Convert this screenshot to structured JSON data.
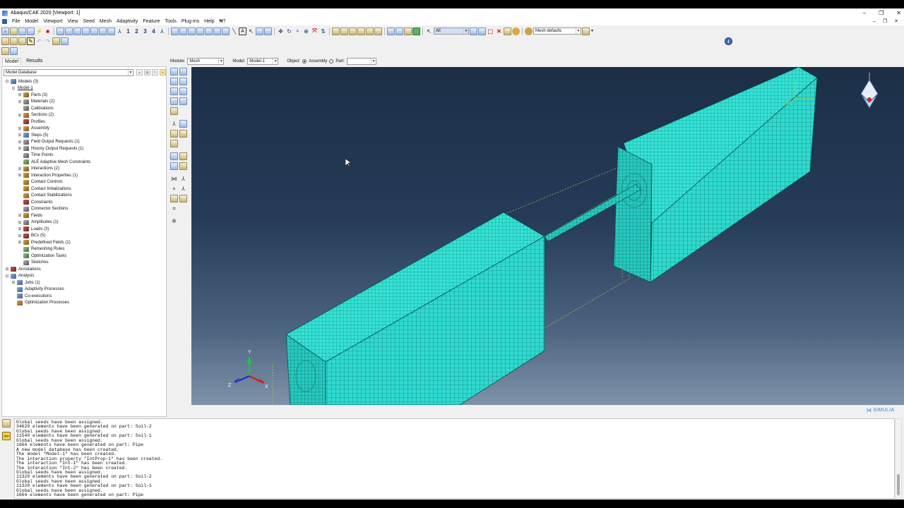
{
  "window": {
    "title": "Abaqus/CAE 2020 [Viewport: 1]",
    "controls": [
      "–",
      "❐",
      "✕"
    ]
  },
  "menu": {
    "items": [
      "File",
      "Model",
      "Viewport",
      "View",
      "Seed",
      "Mesh",
      "Adaptivity",
      "Feature",
      "Tools",
      "Plug-ins",
      "Help",
      "₦?"
    ],
    "right_controls": [
      "–",
      "❐",
      "✕"
    ]
  },
  "toolbar": {
    "numbers": [
      "1",
      "2",
      "3",
      "4"
    ],
    "selection_filter": "All",
    "render_style": "Mesh defaults"
  },
  "left_panel": {
    "tabs": [
      "Model",
      "Results"
    ],
    "tree_combo": "Model Database",
    "tree": [
      {
        "label": "Models (3)",
        "level": 0,
        "expander": "⊟",
        "icon": "c2"
      },
      {
        "label": "Model-1",
        "level": 1,
        "expander": "⊟",
        "icon": "",
        "underline": true
      },
      {
        "label": "Parts (3)",
        "level": 2,
        "expander": "⊞",
        "icon": "c1"
      },
      {
        "label": "Materials (2)",
        "level": 2,
        "expander": "⊞",
        "icon": "c5"
      },
      {
        "label": "Calibrations",
        "level": 2,
        "expander": "",
        "icon": "c5"
      },
      {
        "label": "Sections (2)",
        "level": 2,
        "expander": "⊞",
        "icon": "c1"
      },
      {
        "label": "Profiles",
        "level": 2,
        "expander": "",
        "icon": "c3"
      },
      {
        "label": "Assembly",
        "level": 2,
        "expander": "⊞",
        "icon": "c1"
      },
      {
        "label": "Steps (5)",
        "level": 2,
        "expander": "⊞",
        "icon": "c2"
      },
      {
        "label": "Field Output Requests (1)",
        "level": 2,
        "expander": "⊞",
        "icon": "c5"
      },
      {
        "label": "History Output Requests (1)",
        "level": 2,
        "expander": "⊞",
        "icon": "c5"
      },
      {
        "label": "Time Points",
        "level": 2,
        "expander": "",
        "icon": "c5"
      },
      {
        "label": "ALE Adaptive Mesh Constraints",
        "level": 2,
        "expander": "",
        "icon": "c4"
      },
      {
        "label": "Interactions (2)",
        "level": 2,
        "expander": "⊞",
        "icon": "c1"
      },
      {
        "label": "Interaction Properties (1)",
        "level": 2,
        "expander": "⊞",
        "icon": "c1"
      },
      {
        "label": "Contact Controls",
        "level": 2,
        "expander": "",
        "icon": "c1"
      },
      {
        "label": "Contact Initializations",
        "level": 2,
        "expander": "",
        "icon": "c1"
      },
      {
        "label": "Contact Stabilizations",
        "level": 2,
        "expander": "",
        "icon": "c1"
      },
      {
        "label": "Constraints",
        "level": 2,
        "expander": "",
        "icon": "c3"
      },
      {
        "label": "Connector Sections",
        "level": 2,
        "expander": "",
        "icon": "c5"
      },
      {
        "label": "Fields",
        "level": 2,
        "expander": "⊞",
        "icon": "c1"
      },
      {
        "label": "Amplitudes (1)",
        "level": 2,
        "expander": "⊞",
        "icon": "c5"
      },
      {
        "label": "Loads (3)",
        "level": 2,
        "expander": "⊞",
        "icon": "c3"
      },
      {
        "label": "BCs (5)",
        "level": 2,
        "expander": "⊞",
        "icon": "c3"
      },
      {
        "label": "Predefined Fields (1)",
        "level": 2,
        "expander": "⊞",
        "icon": "c1"
      },
      {
        "label": "Remeshing Rules",
        "level": 2,
        "expander": "",
        "icon": "c4"
      },
      {
        "label": "Optimization Tasks",
        "level": 2,
        "expander": "",
        "icon": "c4"
      },
      {
        "label": "Sketches",
        "level": 2,
        "expander": "",
        "icon": "c5"
      },
      {
        "label": "Annotations",
        "level": 0,
        "expander": "⊞",
        "icon": "c3"
      },
      {
        "label": "Analysis",
        "level": 0,
        "expander": "⊟",
        "icon": "c2"
      },
      {
        "label": "Jobs (1)",
        "level": 1,
        "expander": "⊞",
        "icon": "c2"
      },
      {
        "label": "Adaptivity Processes",
        "level": 1,
        "expander": "",
        "icon": "c2"
      },
      {
        "label": "Co-executions",
        "level": 1,
        "expander": "",
        "icon": "c2"
      },
      {
        "label": "Optimization Processes",
        "level": 1,
        "expander": "",
        "icon": "c1"
      }
    ]
  },
  "context": {
    "module_label": "Module:",
    "module_value": "Mesh",
    "model_label": "Model:",
    "model_value": "Model-1",
    "object_label": "Object:",
    "assembly_label": "Assembly",
    "part_label": "Part:",
    "part_value": ""
  },
  "viewport": {
    "background_top": "#1c2f47",
    "background_bottom": "#7f92aa",
    "mesh_color": "#29d8cc",
    "triad_labels": {
      "x": "X",
      "y": "Y",
      "z": "Z"
    }
  },
  "branding": {
    "text": "SIMULIA"
  },
  "messages": [
    "Global seeds have been assigned.",
    "34620 elements have been generated on part: Soil-2",
    "Global seeds have been assigned.",
    "11540 elements have been generated on part: Soil-1",
    "Global seeds have been assigned.",
    "1664 elements have been generated on part: Pipe",
    "A new model database has been created.",
    "The model \"Model-1\" has been created.",
    "The interaction property \"IntProp-1\" has been created.",
    "The interaction \"Int-1\" has been created.",
    "The interaction \"Int-2\" has been created.",
    "Global seeds have been assigned.",
    "11320 elements have been generated on part: Soil-2",
    "Global seeds have been assigned.",
    "11320 elements have been generated on part: Soil-1",
    "Global seeds have been assigned.",
    "1664 elements have been generated on part: Pipe"
  ]
}
